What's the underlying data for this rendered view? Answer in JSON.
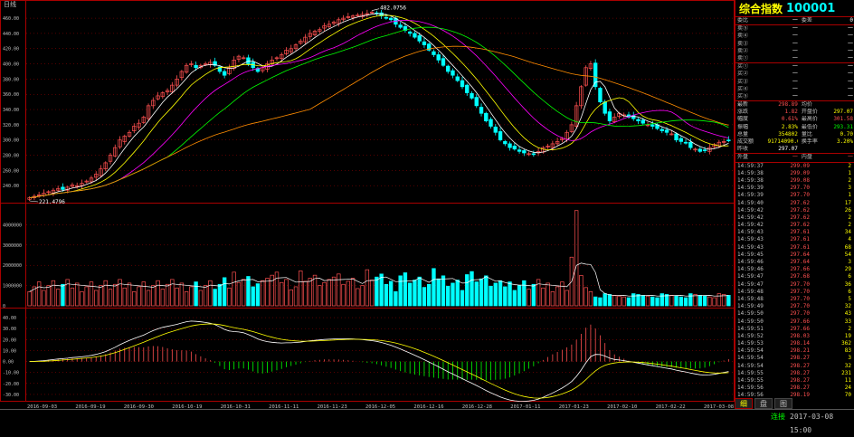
{
  "window": {
    "period_label": "日线"
  },
  "stock": {
    "name": "综合指数",
    "code": "100001"
  },
  "colors": {
    "up": "#ff5050",
    "down": "#00ffff",
    "ma5": "#ffffff",
    "ma10": "#ffff00",
    "ma20": "#ff00ff",
    "ma30": "#00ff00",
    "ma60": "#ff8c00"
  },
  "quote_rows": [
    {
      "l1": "委比",
      "v1": "一",
      "l2": "委差",
      "v2": "0"
    },
    {
      "l1": "卖⑤",
      "v1": "一",
      "l2": "",
      "v2": "一"
    },
    {
      "l1": "卖④",
      "v1": "一",
      "l2": "",
      "v2": "一"
    },
    {
      "l1": "卖③",
      "v1": "一",
      "l2": "",
      "v2": "一"
    },
    {
      "l1": "卖②",
      "v1": "一",
      "l2": "",
      "v2": "一"
    },
    {
      "l1": "卖①",
      "v1": "一",
      "l2": "",
      "v2": "一"
    },
    {
      "l1": "买①",
      "v1": "一",
      "l2": "",
      "v2": "一"
    },
    {
      "l1": "买②",
      "v1": "一",
      "l2": "",
      "v2": "一"
    },
    {
      "l1": "买③",
      "v1": "一",
      "l2": "",
      "v2": "一"
    },
    {
      "l1": "买④",
      "v1": "一",
      "l2": "",
      "v2": "一"
    },
    {
      "l1": "买⑤",
      "v1": "一",
      "l2": "",
      "v2": "一"
    }
  ],
  "stats_rows": [
    {
      "l1": "最新",
      "v1": "298.89",
      "l2": "均价",
      "v2": ""
    },
    {
      "l1": "涨跌",
      "v1": "1.82",
      "l2": "开盘价",
      "v2": "297.07"
    },
    {
      "l1": "幅度",
      "v1": "0.61%",
      "l2": "最高价",
      "v2": "301.58"
    },
    {
      "l1": "振幅",
      "v1": "2.83%",
      "l2": "最低价",
      "v2": "293.31"
    },
    {
      "l1": "总量",
      "v1": "354802",
      "l2": "量比",
      "v2": "0.70"
    },
    {
      "l1": "成交额",
      "v1": "91714090.00",
      "l2": "换手率",
      "v2": "3.20%"
    },
    {
      "l1": "昨收",
      "v1": "297.07",
      "l2": "",
      "v2": ""
    }
  ],
  "trade_header": {
    "outer": "外盘",
    "outer_val": "一",
    "inner": "内盘",
    "inner_val": "一"
  },
  "trades": [
    {
      "time": "14:59:37",
      "price": "299.09",
      "vol": "2"
    },
    {
      "time": "14:59:38",
      "price": "299.09",
      "vol": "1"
    },
    {
      "time": "14:59:38",
      "price": "299.08",
      "vol": "2"
    },
    {
      "time": "14:59:39",
      "price": "297.70",
      "vol": "3"
    },
    {
      "time": "14:59:39",
      "price": "297.70",
      "vol": "1"
    },
    {
      "time": "14:59:40",
      "price": "297.62",
      "vol": "17"
    },
    {
      "time": "14:59:42",
      "price": "297.62",
      "vol": "26"
    },
    {
      "time": "14:59:42",
      "price": "297.62",
      "vol": "2"
    },
    {
      "time": "14:59:42",
      "price": "297.62",
      "vol": "2"
    },
    {
      "time": "14:59:43",
      "price": "297.61",
      "vol": "34"
    },
    {
      "time": "14:59:43",
      "price": "297.61",
      "vol": "4"
    },
    {
      "time": "14:59:43",
      "price": "297.61",
      "vol": "68"
    },
    {
      "time": "14:59:45",
      "price": "297.64",
      "vol": "54"
    },
    {
      "time": "14:59:46",
      "price": "297.64",
      "vol": "3"
    },
    {
      "time": "14:59:46",
      "price": "297.66",
      "vol": "29"
    },
    {
      "time": "14:59:47",
      "price": "297.68",
      "vol": "6"
    },
    {
      "time": "14:59:47",
      "price": "297.70",
      "vol": "36"
    },
    {
      "time": "14:59:48",
      "price": "297.70",
      "vol": "6"
    },
    {
      "time": "14:59:48",
      "price": "297.70",
      "vol": "5"
    },
    {
      "time": "14:59:49",
      "price": "297.70",
      "vol": "32"
    },
    {
      "time": "14:59:50",
      "price": "297.70",
      "vol": "43"
    },
    {
      "time": "14:59:50",
      "price": "297.66",
      "vol": "33"
    },
    {
      "time": "14:59:51",
      "price": "297.66",
      "vol": "2"
    },
    {
      "time": "14:59:52",
      "price": "298.03",
      "vol": "19"
    },
    {
      "time": "14:59:53",
      "price": "298.14",
      "vol": "362"
    },
    {
      "time": "14:59:54",
      "price": "298.21",
      "vol": "83"
    },
    {
      "time": "14:59:54",
      "price": "298.27",
      "vol": "3"
    },
    {
      "time": "14:59:54",
      "price": "298.27",
      "vol": "32"
    },
    {
      "time": "14:59:55",
      "price": "298.27",
      "vol": "231"
    },
    {
      "time": "14:59:55",
      "price": "298.27",
      "vol": "11"
    },
    {
      "time": "14:59:56",
      "price": "298.27",
      "vol": "24"
    },
    {
      "time": "14:59:56",
      "price": "298.19",
      "vol": "70"
    },
    {
      "time": "14:59:56",
      "price": "298.07",
      "vol": "1"
    },
    {
      "time": "14:59:57",
      "price": "298.66",
      "vol": "11"
    },
    {
      "time": "14:59:58",
      "price": "298.50",
      "vol": "5"
    },
    {
      "time": "14:59:59",
      "price": "298.67",
      "vol": "21"
    },
    {
      "time": "15:00:00",
      "price": "298.65",
      "vol": "36"
    },
    {
      "time": "15:00:00",
      "price": "298.84",
      "vol": "24"
    }
  ],
  "tabs": [
    {
      "label": "细"
    },
    {
      "label": "盘"
    },
    {
      "label": "图"
    }
  ],
  "status": {
    "connection": "连接",
    "datetime": "2017-03-08 15:00"
  },
  "chart_data": {
    "type": "candlestick",
    "price_axis": {
      "ticks": [
        "460.00",
        "440.00",
        "420.00",
        "400.00",
        "380.00",
        "360.00",
        "340.00",
        "320.00",
        "300.00",
        "280.00",
        "260.00",
        "240.00"
      ],
      "ylim": [
        220,
        472
      ]
    },
    "volume_axis": {
      "ticks": [
        "4000000",
        "3000000",
        "2000000",
        "1000000",
        "0"
      ],
      "ylim": [
        0,
        5000000
      ]
    },
    "macd_axis": {
      "ticks": [
        "40.00",
        "30.00",
        "20.00",
        "10.00",
        "0.00",
        "-10.00",
        "-20.00",
        "-30.00"
      ],
      "ylim": [
        -35,
        45
      ]
    },
    "x_labels": [
      "2016-09-03",
      "2016-09-19",
      "2016-09-30",
      "2016-10-19",
      "2016-10-31",
      "2016-11-11",
      "2016-11-23",
      "2016-12-05",
      "2016-12-16",
      "2016-12-28",
      "2017-01-11",
      "2017-01-23",
      "2017-02-10",
      "2017-02-22",
      "2017-03-08"
    ],
    "annotations": [
      {
        "label": "482.0756"
      },
      {
        "label": "221.4796"
      }
    ],
    "close_series": [
      224,
      226,
      228,
      230,
      232,
      234,
      236,
      235,
      238,
      241,
      240,
      243,
      246,
      250,
      255,
      262,
      270,
      280,
      290,
      300,
      305,
      310,
      318,
      322,
      330,
      345,
      352,
      358,
      362,
      365,
      372,
      380,
      390,
      398,
      400,
      395,
      398,
      400,
      402,
      398,
      390,
      385,
      395,
      405,
      410,
      408,
      400,
      395,
      390,
      395,
      400,
      405,
      408,
      412,
      418,
      420,
      425,
      430,
      435,
      440,
      443,
      445,
      450,
      452,
      455,
      458,
      460,
      462,
      463,
      464,
      465,
      466,
      468,
      466,
      463,
      460,
      458,
      452,
      448,
      444,
      440,
      435,
      430,
      425,
      418,
      412,
      405,
      398,
      390,
      385,
      378,
      370,
      362,
      355,
      345,
      335,
      325,
      318,
      310,
      300,
      295,
      290,
      288,
      285,
      283,
      282,
      281,
      285,
      290,
      292,
      295,
      298,
      302,
      310,
      320,
      345,
      370,
      395,
      400,
      370,
      350,
      335,
      325,
      330,
      335,
      333,
      330,
      328,
      325,
      322,
      320,
      318,
      315,
      312,
      310,
      308,
      300,
      298,
      296,
      290,
      288,
      285,
      286,
      290,
      294,
      297,
      298,
      299
    ]
  }
}
